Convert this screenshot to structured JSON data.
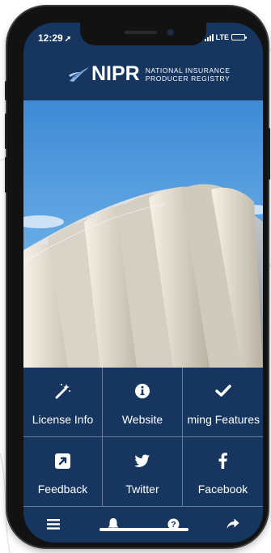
{
  "status_bar": {
    "time": "12:29",
    "network": "LTE"
  },
  "header": {
    "logo_text": "NIPR",
    "org_line1": "NATIONAL INSURANCE",
    "org_line2": "PRODUCER REGISTRY"
  },
  "tiles": [
    {
      "label": "License Info",
      "icon": "magic-wand-icon"
    },
    {
      "label": "Website",
      "icon": "info-circle-icon"
    },
    {
      "label": "ming Features",
      "icon": "checkmark-icon"
    },
    {
      "label": "Feedback",
      "icon": "external-link-icon"
    },
    {
      "label": "Twitter",
      "icon": "twitter-icon"
    },
    {
      "label": "Facebook",
      "icon": "facebook-icon"
    }
  ],
  "tab_bar": [
    "menu-icon",
    "bell-icon",
    "help-icon",
    "share-icon"
  ],
  "colors": {
    "brand_navy": "#16365f",
    "sky": "#5aa3e0"
  }
}
